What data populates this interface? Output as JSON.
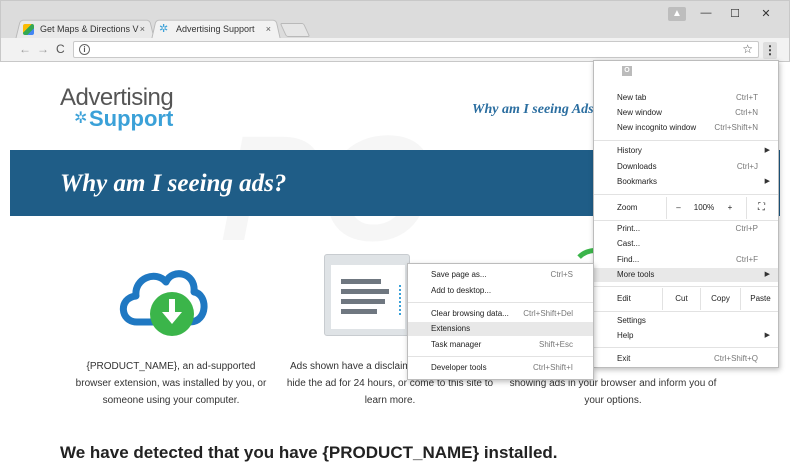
{
  "browser": {
    "tabs": [
      {
        "title": "Get Maps & Directions V",
        "close": "×"
      },
      {
        "title": "Advertising Support",
        "close": "×"
      }
    ],
    "window_buttons": {
      "minimize": "—",
      "maximize": "☐",
      "close": "✕"
    },
    "nav": {
      "back": "←",
      "forward": "→",
      "reload": "C"
    },
    "address_value": "",
    "menu_button": "⋮"
  },
  "page": {
    "logo_line1": "Advertising",
    "logo_line2": "Support",
    "header_question": "Why am I seeing Ads?",
    "banner_title": "Why am I seeing ads?",
    "col1_text": "{PRODUCT_NAME}, an ad-supported browser extension, was installed by you, or someone using your computer.",
    "col2_text": "Ads shown have a disclaime... hide the ad for 24 hours, or come to this site to learn more.",
    "col2_line1": "Ads shown have a disclaime",
    "col2_line2": "hide the ad for 24 hours, or come to this site to",
    "col2_line3": "learn more.",
    "col3_line1": "showing ads in your browser and inform you of",
    "col3_line2": "your options.",
    "bottom_heading": "We have detected that you have {PRODUCT_NAME} installed."
  },
  "chrome_menu": {
    "new_tab": {
      "label": "New tab",
      "shortcut": "Ctrl+T"
    },
    "new_window": {
      "label": "New window",
      "shortcut": "Ctrl+N"
    },
    "new_incognito": {
      "label": "New incognito window",
      "shortcut": "Ctrl+Shift+N"
    },
    "history": {
      "label": "History"
    },
    "downloads": {
      "label": "Downloads",
      "shortcut": "Ctrl+J"
    },
    "bookmarks": {
      "label": "Bookmarks"
    },
    "zoom": {
      "label": "Zoom",
      "minus": "–",
      "value": "100%",
      "plus": "+"
    },
    "print": {
      "label": "Print...",
      "shortcut": "Ctrl+P"
    },
    "cast": {
      "label": "Cast..."
    },
    "find": {
      "label": "Find...",
      "shortcut": "Ctrl+F"
    },
    "more_tools": {
      "label": "More tools"
    },
    "edit": {
      "label": "Edit",
      "cut": "Cut",
      "copy": "Copy",
      "paste": "Paste"
    },
    "settings": {
      "label": "Settings"
    },
    "help": {
      "label": "Help"
    },
    "exit": {
      "label": "Exit",
      "shortcut": "Ctrl+Shift+Q"
    }
  },
  "more_tools_menu": {
    "save_page": {
      "label": "Save page as...",
      "shortcut": "Ctrl+S"
    },
    "add_desktop": {
      "label": "Add to desktop..."
    },
    "clear_data": {
      "label": "Clear browsing data...",
      "shortcut": "Ctrl+Shift+Del"
    },
    "extensions": {
      "label": "Extensions"
    },
    "task_manager": {
      "label": "Task manager",
      "shortcut": "Shift+Esc"
    },
    "dev_tools": {
      "label": "Developer tools",
      "shortcut": "Ctrl+Shift+I"
    }
  },
  "icons": {
    "maps_favicon": "maps-favicon-icon",
    "gear_favicon": "gear-icon",
    "info": "info-icon",
    "star": "star-icon",
    "fullscreen": "fullscreen-icon",
    "cloud_download": "cloud-download-icon",
    "office": "office-icon"
  },
  "colors": {
    "brand_blue": "#3ba1d8",
    "banner_blue": "#1f5d87",
    "download_green": "#3bb54a",
    "highlight": "#e8e8e8"
  }
}
